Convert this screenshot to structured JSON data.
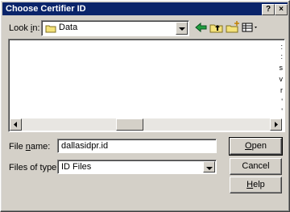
{
  "window": {
    "title": "Choose Certifier ID"
  },
  "titlebar_buttons": {
    "help": "?",
    "close": "×"
  },
  "look_in": {
    "label_pre": "Look ",
    "label_u": "i",
    "label_post": "n:",
    "value": "Data"
  },
  "filename": {
    "label_pre": "File ",
    "label_u": "n",
    "label_post": "ame:",
    "value": "dallasidpr.id"
  },
  "filetype": {
    "label": "Files of type:",
    "value": "ID Files"
  },
  "buttons": {
    "open_u": "O",
    "open_rest": "pen",
    "cancel": "Cancel",
    "help_u": "H",
    "help_rest": "elp"
  },
  "toolbar_icons": [
    "back-arrow-icon",
    "up-folder-icon",
    "new-folder-icon",
    "view-menu-icon"
  ],
  "list_edge_chars": [
    ":",
    ":",
    "s",
    "v",
    "r",
    "'",
    "'"
  ]
}
